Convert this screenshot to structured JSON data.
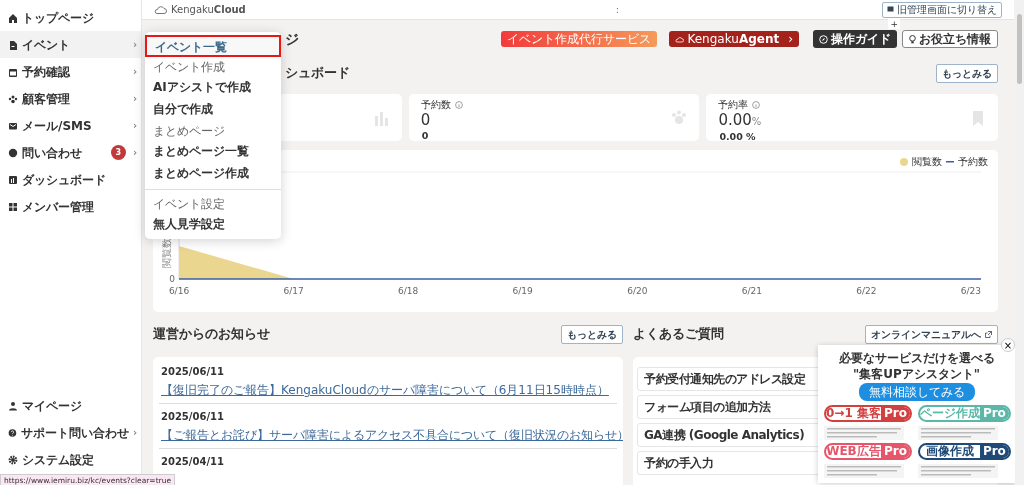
{
  "header": {
    "logo": "Kengaku**Cloud**",
    "menu_dots": ":",
    "switch_button": "旧管理画面に切り替え",
    "plus": "+"
  },
  "sidebar": {
    "items": [
      {
        "label": "トップページ",
        "selected": false
      },
      {
        "label": "イベント",
        "selected": true,
        "chevron": "›"
      },
      {
        "label": "予約確認",
        "selected": false,
        "chevron": "›"
      },
      {
        "label": "顧客管理",
        "selected": false,
        "chevron": "›"
      },
      {
        "label": "メール/SMS",
        "selected": false,
        "chevron": "›"
      },
      {
        "label": "問い合わせ",
        "selected": false,
        "chevron": "›",
        "badge": "3"
      },
      {
        "label": "ダッシュボード",
        "selected": false
      },
      {
        "label": "メンバー管理",
        "selected": false
      }
    ],
    "bottom_items": [
      {
        "label": "マイページ"
      },
      {
        "label": "サポート問い合わせ",
        "chevron": "›"
      },
      {
        "label": "システム設定"
      }
    ]
  },
  "dropdown": {
    "entries": [
      {
        "kind": "item",
        "label": "イベント一覧",
        "selected": true
      },
      {
        "kind": "header",
        "label": "イベント作成"
      },
      {
        "kind": "item",
        "label": "AIアシストで作成",
        "selected": false
      },
      {
        "kind": "item",
        "label": "自分で作成",
        "selected": false
      },
      {
        "kind": "header",
        "label": "まとめページ"
      },
      {
        "kind": "item",
        "label": "まとめページ一覧",
        "selected": false
      },
      {
        "kind": "item",
        "label": "まとめページ作成",
        "selected": false
      },
      {
        "kind": "divider"
      },
      {
        "kind": "header",
        "label": "イベント設定"
      },
      {
        "kind": "item",
        "label": "無人見学設定",
        "selected": false
      }
    ]
  },
  "page_title": "ジ",
  "top_buttons": [
    {
      "kind": "service",
      "label": "イベント作成代行サービス"
    },
    {
      "kind": "agent",
      "label": "Kengaku**Agent**",
      "chevron": "›"
    },
    {
      "kind": "guide",
      "label": "操作ガイド"
    },
    {
      "kind": "info",
      "label": "お役立ち情報"
    }
  ],
  "dashboard": {
    "heading": "シュボード",
    "more_button": "もっとみる",
    "stats": [
      {
        "kind": "views"
      },
      {
        "kind": "bookings",
        "label": "予約数",
        "value": "0",
        "sub": "0"
      },
      {
        "kind": "rate",
        "label": "予約率",
        "value": "0.00",
        "unit": "%",
        "sub": "0.00 %"
      }
    ],
    "chart": {
      "legend": [
        {
          "label": "閲覧数",
          "color": "#ead68f",
          "kind": "area"
        },
        {
          "label": "予約数",
          "color": "#3a5fa8",
          "kind": "line"
        }
      ],
      "y_label": "閲覧数",
      "y_tick": "0",
      "x_labels": [
        "6/16",
        "6/17",
        "6/18",
        "6/19",
        "6/20",
        "6/21",
        "6/22",
        "6/23"
      ]
    }
  },
  "news": {
    "heading": "運営からのお知らせ",
    "more_button": "もっとみる",
    "items": [
      {
        "date": "2025/06/11",
        "title": "【復旧完了のご報告】KengakuCloudのサーバ障害について（6月11日15時時点）"
      },
      {
        "date": "2025/06/11",
        "title": "【ご報告とお詫び】サーバ障害によるアクセス不具合について（復旧状況のお知らせ）"
      },
      {
        "date": "2025/04/11"
      }
    ]
  },
  "faq": {
    "heading": "よくあるご質問",
    "manual_button": "オンラインマニュアルへ",
    "items": [
      "予約受付通知先のアドレス設定",
      "フォーム項目の追加方法",
      "GA連携 (Google Analytics)",
      "予約の手入力"
    ]
  },
  "promo": {
    "close": "×",
    "subtitle": "必要なサービスだけを選べる",
    "title": "\"集客UPアシスタント\"",
    "cta": "無料相談してみる",
    "cards": [
      {
        "label": "0→1 集客",
        "tag": "Pro",
        "color": "#d2403f"
      },
      {
        "label": "ページ作成",
        "tag": "Pro",
        "color": "#5bb8a8"
      },
      {
        "label": "WEB広告",
        "tag": "Pro",
        "color": "#e4576a"
      },
      {
        "label": "画像作成",
        "tag": "Pro",
        "color": "#1f4a78"
      }
    ]
  },
  "status_url": "https://www.iemiru.biz/kc/events?clear=true"
}
